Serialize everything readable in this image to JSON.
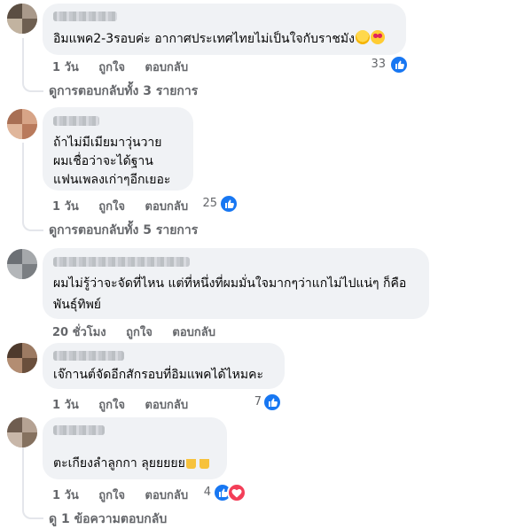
{
  "comments": [
    {
      "text_lines": [
        "อิมแพค2-3รอบค่ะ อากาศประเทศไทยไม่เป็นใจกับราชมัง"
      ],
      "emojis": [
        "laughing-face-emoji",
        "heart-eyes-emoji"
      ],
      "time": "1 วัน",
      "like": "ถูกใจ",
      "reply": "ตอบกลับ",
      "reaction_count": "33",
      "reactions": [
        "like"
      ],
      "view_replies": "ดูการตอบกลับทั้ง 3 รายการ"
    },
    {
      "text_lines": [
        "ถ้าไม่มีเมียมาวุ่นวาย",
        "ผมเชื่อว่าจะได้ฐาน",
        "แฟนเพลงเก่าๆอีกเยอะ"
      ],
      "time": "1 วัน",
      "like": "ถูกใจ",
      "reply": "ตอบกลับ",
      "reaction_count": "25",
      "reactions": [
        "like"
      ],
      "view_replies": "ดูการตอบกลับทั้ง 5 รายการ"
    },
    {
      "text_lines": [
        "ผมไม่รู้ว่าจะจัดที่ไหน แต่ที่หนึ่งที่ผมมั่นใจมากๆว่าแกไม่ไปแน่ๆ ก็คือ",
        "พันธุ์ทิพย์"
      ],
      "time": "20 ชั่วโมง",
      "like": "ถูกใจ",
      "reply": "ตอบกลับ"
    },
    {
      "text_lines": [
        "เจ๊กานต์จัดอีกสักรอบที่อิมแพคได้ไหมคะ"
      ],
      "time": "1 วัน",
      "like": "ถูกใจ",
      "reply": "ตอบกลับ",
      "reaction_count": "7",
      "reactions": [
        "like"
      ]
    },
    {
      "text_lines": [
        "ตะเกียงลำลูกกา ลุยยยยย"
      ],
      "emojis": [
        "victory-hand-emoji",
        "victory-hand-emoji"
      ],
      "time": "1 วัน",
      "like": "ถูกใจ",
      "reply": "ตอบกลับ",
      "reaction_count": "4",
      "reactions": [
        "like",
        "love"
      ],
      "view_replies": "ดู 1 ข้อความตอบกลับ"
    }
  ],
  "colors": {
    "bubble": "#f0f2f5",
    "meta_text": "#65676b",
    "like_blue": "#1877f2",
    "love_red": "#f33e58",
    "thread_line": "#e4e6eb"
  }
}
